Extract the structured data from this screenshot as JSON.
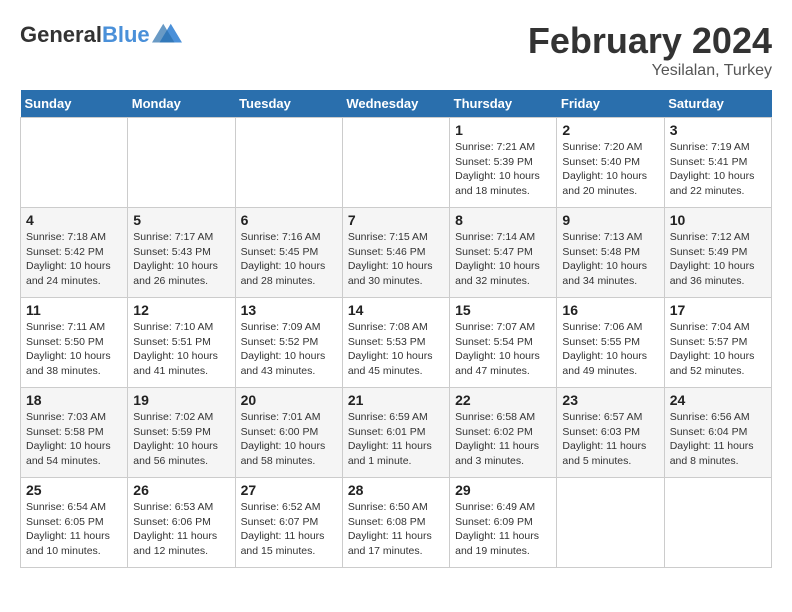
{
  "header": {
    "logo_general": "General",
    "logo_blue": "Blue",
    "title": "February 2024",
    "subtitle": "Yesilalan, Turkey"
  },
  "calendar": {
    "weekdays": [
      "Sunday",
      "Monday",
      "Tuesday",
      "Wednesday",
      "Thursday",
      "Friday",
      "Saturday"
    ],
    "weeks": [
      [
        {
          "day": "",
          "info": ""
        },
        {
          "day": "",
          "info": ""
        },
        {
          "day": "",
          "info": ""
        },
        {
          "day": "",
          "info": ""
        },
        {
          "day": "1",
          "info": "Sunrise: 7:21 AM\nSunset: 5:39 PM\nDaylight: 10 hours\nand 18 minutes."
        },
        {
          "day": "2",
          "info": "Sunrise: 7:20 AM\nSunset: 5:40 PM\nDaylight: 10 hours\nand 20 minutes."
        },
        {
          "day": "3",
          "info": "Sunrise: 7:19 AM\nSunset: 5:41 PM\nDaylight: 10 hours\nand 22 minutes."
        }
      ],
      [
        {
          "day": "4",
          "info": "Sunrise: 7:18 AM\nSunset: 5:42 PM\nDaylight: 10 hours\nand 24 minutes."
        },
        {
          "day": "5",
          "info": "Sunrise: 7:17 AM\nSunset: 5:43 PM\nDaylight: 10 hours\nand 26 minutes."
        },
        {
          "day": "6",
          "info": "Sunrise: 7:16 AM\nSunset: 5:45 PM\nDaylight: 10 hours\nand 28 minutes."
        },
        {
          "day": "7",
          "info": "Sunrise: 7:15 AM\nSunset: 5:46 PM\nDaylight: 10 hours\nand 30 minutes."
        },
        {
          "day": "8",
          "info": "Sunrise: 7:14 AM\nSunset: 5:47 PM\nDaylight: 10 hours\nand 32 minutes."
        },
        {
          "day": "9",
          "info": "Sunrise: 7:13 AM\nSunset: 5:48 PM\nDaylight: 10 hours\nand 34 minutes."
        },
        {
          "day": "10",
          "info": "Sunrise: 7:12 AM\nSunset: 5:49 PM\nDaylight: 10 hours\nand 36 minutes."
        }
      ],
      [
        {
          "day": "11",
          "info": "Sunrise: 7:11 AM\nSunset: 5:50 PM\nDaylight: 10 hours\nand 38 minutes."
        },
        {
          "day": "12",
          "info": "Sunrise: 7:10 AM\nSunset: 5:51 PM\nDaylight: 10 hours\nand 41 minutes."
        },
        {
          "day": "13",
          "info": "Sunrise: 7:09 AM\nSunset: 5:52 PM\nDaylight: 10 hours\nand 43 minutes."
        },
        {
          "day": "14",
          "info": "Sunrise: 7:08 AM\nSunset: 5:53 PM\nDaylight: 10 hours\nand 45 minutes."
        },
        {
          "day": "15",
          "info": "Sunrise: 7:07 AM\nSunset: 5:54 PM\nDaylight: 10 hours\nand 47 minutes."
        },
        {
          "day": "16",
          "info": "Sunrise: 7:06 AM\nSunset: 5:55 PM\nDaylight: 10 hours\nand 49 minutes."
        },
        {
          "day": "17",
          "info": "Sunrise: 7:04 AM\nSunset: 5:57 PM\nDaylight: 10 hours\nand 52 minutes."
        }
      ],
      [
        {
          "day": "18",
          "info": "Sunrise: 7:03 AM\nSunset: 5:58 PM\nDaylight: 10 hours\nand 54 minutes."
        },
        {
          "day": "19",
          "info": "Sunrise: 7:02 AM\nSunset: 5:59 PM\nDaylight: 10 hours\nand 56 minutes."
        },
        {
          "day": "20",
          "info": "Sunrise: 7:01 AM\nSunset: 6:00 PM\nDaylight: 10 hours\nand 58 minutes."
        },
        {
          "day": "21",
          "info": "Sunrise: 6:59 AM\nSunset: 6:01 PM\nDaylight: 11 hours\nand 1 minute."
        },
        {
          "day": "22",
          "info": "Sunrise: 6:58 AM\nSunset: 6:02 PM\nDaylight: 11 hours\nand 3 minutes."
        },
        {
          "day": "23",
          "info": "Sunrise: 6:57 AM\nSunset: 6:03 PM\nDaylight: 11 hours\nand 5 minutes."
        },
        {
          "day": "24",
          "info": "Sunrise: 6:56 AM\nSunset: 6:04 PM\nDaylight: 11 hours\nand 8 minutes."
        }
      ],
      [
        {
          "day": "25",
          "info": "Sunrise: 6:54 AM\nSunset: 6:05 PM\nDaylight: 11 hours\nand 10 minutes."
        },
        {
          "day": "26",
          "info": "Sunrise: 6:53 AM\nSunset: 6:06 PM\nDaylight: 11 hours\nand 12 minutes."
        },
        {
          "day": "27",
          "info": "Sunrise: 6:52 AM\nSunset: 6:07 PM\nDaylight: 11 hours\nand 15 minutes."
        },
        {
          "day": "28",
          "info": "Sunrise: 6:50 AM\nSunset: 6:08 PM\nDaylight: 11 hours\nand 17 minutes."
        },
        {
          "day": "29",
          "info": "Sunrise: 6:49 AM\nSunset: 6:09 PM\nDaylight: 11 hours\nand 19 minutes."
        },
        {
          "day": "",
          "info": ""
        },
        {
          "day": "",
          "info": ""
        }
      ]
    ]
  }
}
